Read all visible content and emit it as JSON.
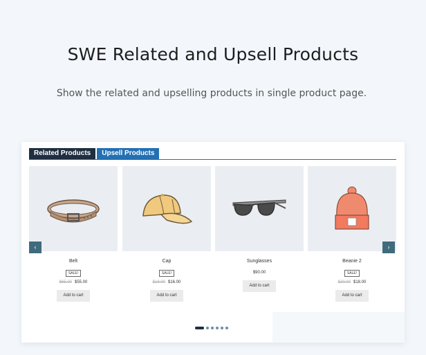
{
  "hero": {
    "title": "SWE Related and Upsell Products",
    "subtitle": "Show the related and upselling products in single product page."
  },
  "tabs": [
    {
      "label": "Related Products",
      "active": true
    },
    {
      "label": "Upsell Products",
      "active": false
    }
  ],
  "products": [
    {
      "name": "Belt",
      "sale_badge": "SALE!",
      "old_price": "$65.00",
      "price": "$55.00",
      "button": "Add to cart",
      "icon": "belt-icon"
    },
    {
      "name": "Cap",
      "sale_badge": "SALE!",
      "old_price": "$18.00",
      "price": "$16.00",
      "button": "Add to cart",
      "icon": "cap-icon"
    },
    {
      "name": "Sunglasses",
      "price": "$90.00",
      "button": "Add to cart",
      "icon": "sunglasses-icon"
    },
    {
      "name": "Beanie 2",
      "sale_badge": "SALE!",
      "old_price": "$20.00",
      "price": "$18.00",
      "button": "Add to cart",
      "icon": "beanie-icon"
    }
  ],
  "carousel": {
    "prev_icon": "chevron-left-icon",
    "next_icon": "chevron-right-icon",
    "prev_glyph": "‹",
    "next_glyph": "›",
    "dots": 6,
    "active_dot": 0
  },
  "colors": {
    "tab_related": "#1f2e40",
    "tab_upsell": "#2370b3",
    "arrow": "#3f6b7d"
  }
}
